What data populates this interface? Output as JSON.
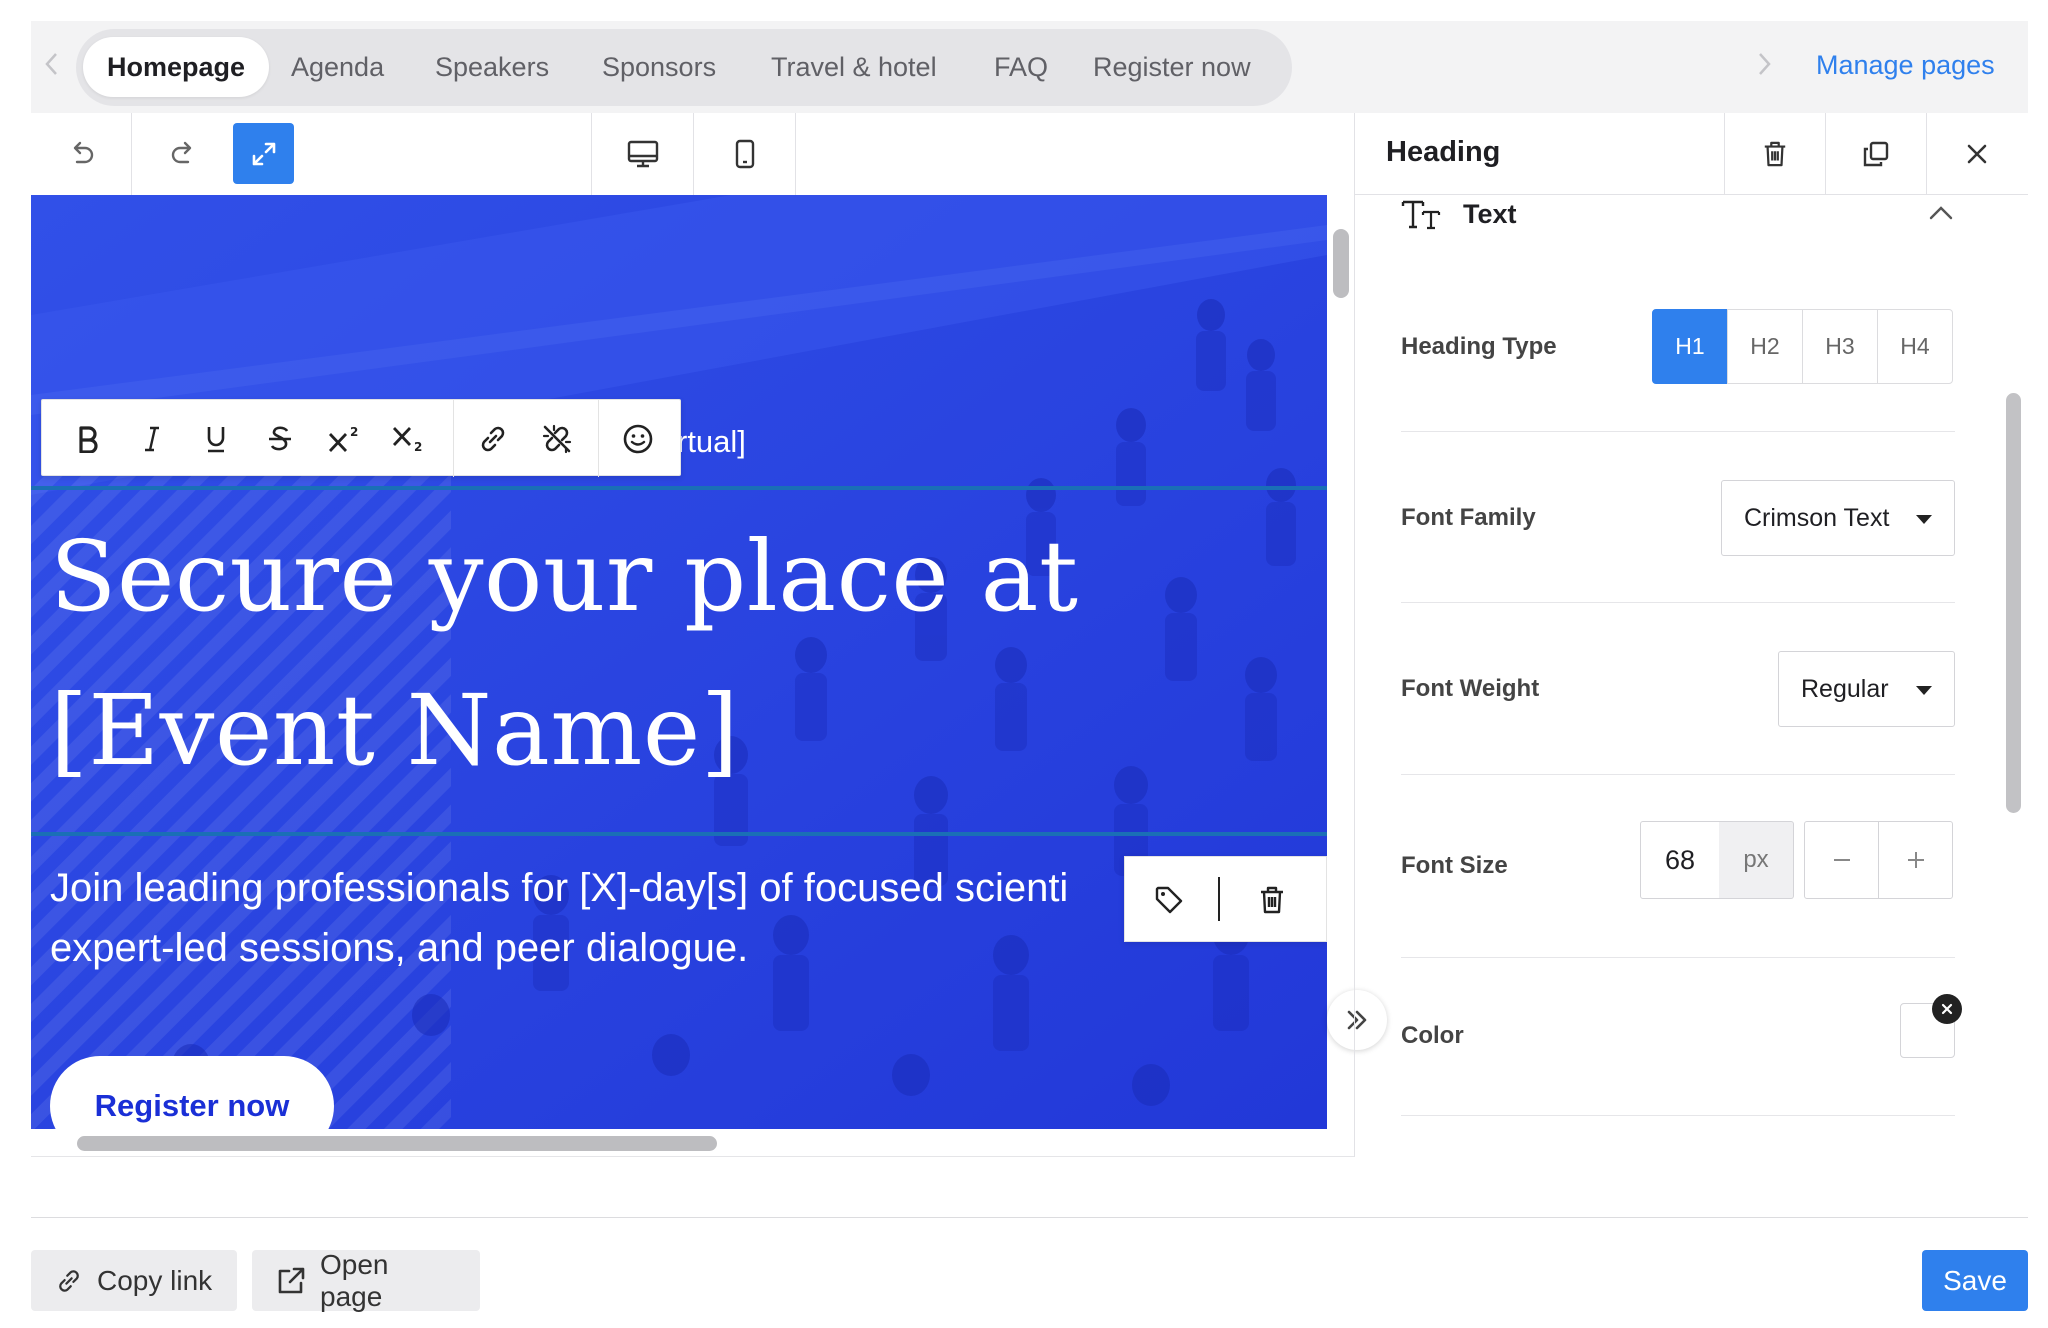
{
  "nav": {
    "tabs": [
      {
        "label": "Homepage",
        "active": true
      },
      {
        "label": "Agenda"
      },
      {
        "label": "Speakers"
      },
      {
        "label": "Sponsors"
      },
      {
        "label": "Travel & hotel"
      },
      {
        "label": "FAQ"
      },
      {
        "label": "Register now"
      }
    ],
    "manage_pages": "Manage pages"
  },
  "toolbar": {
    "icons": [
      "undo-icon",
      "redo-icon",
      "expand-icon",
      "desktop-icon",
      "mobile-icon"
    ]
  },
  "canvas": {
    "subline_visible": "rtual]",
    "heading_line1": "Secure your place at",
    "heading_line2": "[Event Name]",
    "paragraph_line1": "Join leading professionals for [X]-day[s] of focused scienti",
    "paragraph_line2": "expert-led sessions, and peer dialogue.",
    "register_button": "Register now",
    "background_color": "#2b44e6"
  },
  "format_toolbar": {
    "icons": [
      "bold-icon",
      "italic-icon",
      "underline-icon",
      "strikethrough-icon",
      "superscript-icon",
      "subscript-icon",
      "link-icon",
      "unlink-icon",
      "emoji-icon"
    ]
  },
  "panel": {
    "title": "Heading",
    "section": "Text",
    "heading_type_label": "Heading Type",
    "heading_types": [
      "H1",
      "H2",
      "H3",
      "H4"
    ],
    "heading_type_selected": "H1",
    "font_family_label": "Font Family",
    "font_family_value": "Crimson Text",
    "font_weight_label": "Font Weight",
    "font_weight_value": "Regular",
    "font_size_label": "Font Size",
    "font_size_value": "68",
    "font_size_unit": "px",
    "color_label": "Color"
  },
  "footer": {
    "copy_link": "Copy link",
    "open_page": "Open page",
    "save": "Save"
  },
  "colors": {
    "accent": "#2f80ed",
    "hero": "#2b44e6"
  }
}
